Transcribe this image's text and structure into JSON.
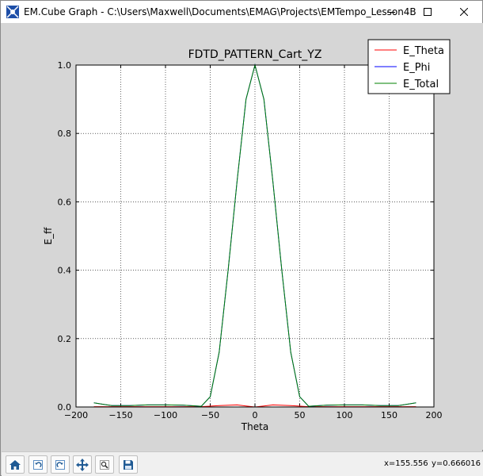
{
  "window": {
    "title": "EM.Cube Graph - C:\\Users\\Maxwell\\Documents\\EMAG\\Projects\\EMTempo_Lesson4B",
    "icon": "app-icon"
  },
  "toolbar": {
    "buttons": [
      "home-icon",
      "back-icon",
      "forward-icon",
      "pan-icon",
      "zoom-icon",
      "save-icon"
    ],
    "x_readout": "x=155.556",
    "y_readout": "y=0.666016"
  },
  "chart_data": {
    "type": "line",
    "title": "FDTD_PATTERN_Cart_YZ",
    "xlabel": "Theta",
    "ylabel": "E_ff",
    "xlim": [
      -200,
      200
    ],
    "ylim": [
      0,
      1
    ],
    "xticks": [
      -200,
      -150,
      -100,
      -50,
      0,
      50,
      100,
      150,
      200
    ],
    "yticks": [
      0.0,
      0.2,
      0.4,
      0.6,
      0.8,
      1.0
    ],
    "xtick_labels": [
      "−200",
      "−150",
      "−100",
      "−50",
      "0",
      "50",
      "100",
      "150",
      "200"
    ],
    "ytick_labels": [
      "0.0",
      "0.2",
      "0.4",
      "0.6",
      "0.8",
      "1.0"
    ],
    "grid": true,
    "legend_position": "top-right",
    "series": [
      {
        "name": "E_Theta",
        "color": "#ff0000",
        "x": [
          -180,
          -140,
          -100,
          -60,
          -40,
          -20,
          -10,
          0,
          10,
          20,
          40,
          60,
          100,
          140,
          180
        ],
        "y": [
          0.001,
          0.001,
          0.001,
          0.001,
          0.004,
          0.006,
          0.003,
          0.0,
          0.003,
          0.006,
          0.004,
          0.001,
          0.001,
          0.001,
          0.001
        ]
      },
      {
        "name": "E_Phi",
        "color": "#0000ff",
        "x": [
          -180,
          -160,
          -140,
          -120,
          -100,
          -80,
          -60,
          -50,
          -40,
          -30,
          -20,
          -10,
          0,
          10,
          20,
          30,
          40,
          50,
          60,
          80,
          100,
          120,
          140,
          160,
          180
        ],
        "y": [
          0.012,
          0.004,
          0.004,
          0.006,
          0.006,
          0.005,
          0.002,
          0.03,
          0.16,
          0.4,
          0.66,
          0.9,
          1.0,
          0.9,
          0.66,
          0.4,
          0.16,
          0.03,
          0.002,
          0.005,
          0.006,
          0.006,
          0.004,
          0.004,
          0.012
        ]
      },
      {
        "name": "E_Total",
        "color": "#008000",
        "x": [
          -180,
          -160,
          -140,
          -120,
          -100,
          -80,
          -60,
          -50,
          -40,
          -30,
          -20,
          -10,
          0,
          10,
          20,
          30,
          40,
          50,
          60,
          80,
          100,
          120,
          140,
          160,
          180
        ],
        "y": [
          0.012,
          0.004,
          0.004,
          0.006,
          0.006,
          0.005,
          0.002,
          0.03,
          0.16,
          0.4,
          0.66,
          0.9,
          1.0,
          0.9,
          0.66,
          0.4,
          0.16,
          0.03,
          0.002,
          0.005,
          0.006,
          0.006,
          0.004,
          0.004,
          0.012
        ]
      }
    ]
  }
}
